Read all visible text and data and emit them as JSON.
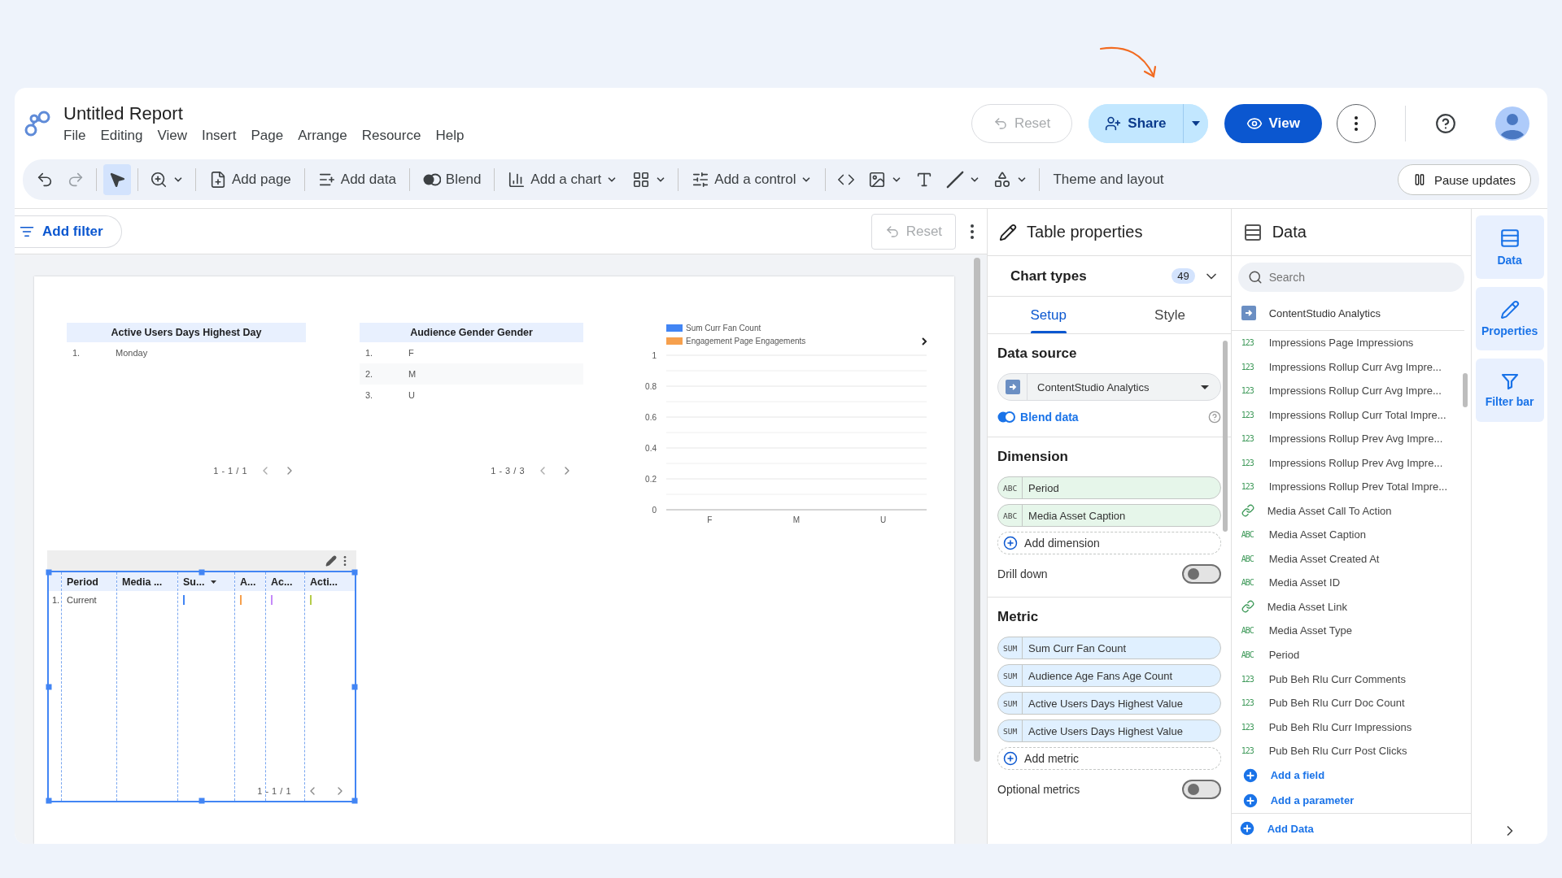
{
  "header": {
    "title": "Untitled Report",
    "menu": [
      "File",
      "Editing",
      "View",
      "Insert",
      "Page",
      "Arrange",
      "Resource",
      "Help"
    ],
    "reset": {
      "label": "Reset",
      "disabled": true
    },
    "share": "Share",
    "view": "View"
  },
  "toolbar": {
    "pointer": {
      "selected": true
    },
    "add_page": "Add page",
    "add_data": "Add data",
    "blend": "Blend",
    "add_chart": "Add a chart",
    "add_control": "Add a control",
    "theme": "Theme and layout",
    "pause": "Pause updates"
  },
  "filter_bar": {
    "add_filter": "Add filter",
    "reset": {
      "label": "Reset",
      "disabled": true
    }
  },
  "canvas": {
    "table_1": {
      "header": "Active Users Days Highest Day",
      "rows": [
        {
          "index": "1.",
          "value": "Monday"
        }
      ],
      "pagination": "1 - 1 / 1"
    },
    "table_2": {
      "header": "Audience Gender Gender",
      "rows": [
        {
          "index": "1.",
          "value": "F"
        },
        {
          "index": "2.",
          "value": "M"
        },
        {
          "index": "3.",
          "value": "U"
        }
      ],
      "pagination": "1 - 3 / 3"
    },
    "chart": {
      "chart_data": {
        "type": "bar",
        "categories": [
          "F",
          "M",
          "U"
        ],
        "series": [
          {
            "name": "Sum Curr Fan Count",
            "color": "#4285f4",
            "values": [
              null,
              null,
              null
            ]
          },
          {
            "name": "Engagement Page Engagements",
            "color": "#f6a04d",
            "values": [
              null,
              null,
              null
            ]
          }
        ],
        "ylim": [
          0,
          1
        ],
        "yticks": [
          0,
          0.2,
          0.4,
          0.6,
          0.8,
          1
        ],
        "grid": true
      }
    },
    "selected_table": {
      "columns": [
        {
          "label": "Period",
          "sorted": false
        },
        {
          "label": "Media ...",
          "sorted": false
        },
        {
          "label": "Su...",
          "sorted": true
        },
        {
          "label": "A...",
          "sorted": false
        },
        {
          "label": "Ac...",
          "sorted": false
        },
        {
          "label": "Acti...",
          "sorted": false
        }
      ],
      "rows": [
        {
          "index": "1.",
          "cells": [
            {
              "kind": "text",
              "text": "Current"
            },
            {
              "kind": "blank"
            },
            {
              "kind": "bar",
              "color": "#4285f4"
            },
            {
              "kind": "bar",
              "color": "#f6a04d"
            },
            {
              "kind": "bar",
              "color": "#c58af9"
            },
            {
              "kind": "bar",
              "color": "#b5cc4a"
            }
          ]
        }
      ],
      "pagination": "1 - 1 / 1"
    }
  },
  "properties": {
    "title": "Table properties",
    "chart_types": {
      "label": "Chart types",
      "count": "49"
    },
    "tabs": [
      {
        "label": "Setup",
        "selected": true
      },
      {
        "label": "Style",
        "selected": false
      }
    ],
    "data_source": {
      "title": "Data source",
      "value": "ContentStudio Analytics",
      "blend": "Blend data"
    },
    "dimension": {
      "title": "Dimension",
      "fields": [
        {
          "type": "ABC",
          "name": "Period"
        },
        {
          "type": "ABC",
          "name": "Media Asset Caption"
        }
      ],
      "add": "Add dimension",
      "drill_down": {
        "label": "Drill down",
        "on": false
      }
    },
    "metric": {
      "title": "Metric",
      "fields": [
        {
          "type": "SUM",
          "name": "Sum Curr Fan Count"
        },
        {
          "type": "SUM",
          "name": "Audience Age Fans Age Count"
        },
        {
          "type": "SUM",
          "name": "Active Users Days Highest Value"
        },
        {
          "type": "SUM",
          "name": "Active Users Days Highest Value"
        }
      ],
      "add": "Add metric",
      "optional": {
        "label": "Optional metrics",
        "on": false
      }
    }
  },
  "data_panel": {
    "title": "Data",
    "search": {
      "placeholder": "Search"
    },
    "source": "ContentStudio Analytics",
    "fields": [
      {
        "kind": "badge",
        "badge": "123",
        "name": "Impressions Page Impressions"
      },
      {
        "kind": "badge",
        "badge": "123",
        "name": "Impressions Rollup Curr Avg Impre..."
      },
      {
        "kind": "badge",
        "badge": "123",
        "name": "Impressions Rollup Curr Avg Impre..."
      },
      {
        "kind": "badge",
        "badge": "123",
        "name": "Impressions Rollup Curr Total Impre..."
      },
      {
        "kind": "badge",
        "badge": "123",
        "name": "Impressions Rollup Prev Avg Impre..."
      },
      {
        "kind": "badge",
        "badge": "123",
        "name": "Impressions Rollup Prev Avg Impre..."
      },
      {
        "kind": "badge",
        "badge": "123",
        "name": "Impressions Rollup Prev Total Impre..."
      },
      {
        "kind": "link",
        "name": "Media Asset Call To Action"
      },
      {
        "kind": "badge",
        "badge": "ABC",
        "name": "Media Asset Caption"
      },
      {
        "kind": "badge",
        "badge": "ABC",
        "name": "Media Asset Created At"
      },
      {
        "kind": "badge",
        "badge": "ABC",
        "name": "Media Asset ID"
      },
      {
        "kind": "link",
        "name": "Media Asset Link"
      },
      {
        "kind": "badge",
        "badge": "ABC",
        "name": "Media Asset Type"
      },
      {
        "kind": "badge",
        "badge": "ABC",
        "name": "Period"
      },
      {
        "kind": "badge",
        "badge": "123",
        "name": "Pub Beh Rlu Curr Comments"
      },
      {
        "kind": "badge",
        "badge": "123",
        "name": "Pub Beh Rlu Curr Doc Count"
      },
      {
        "kind": "badge",
        "badge": "123",
        "name": "Pub Beh Rlu Curr Impressions"
      },
      {
        "kind": "badge",
        "badge": "123",
        "name": "Pub Beh Rlu Curr Post Clicks"
      }
    ],
    "add_field": "Add a field",
    "add_parameter": "Add a parameter",
    "add_data": "Add Data"
  },
  "rail": [
    {
      "kind": "data",
      "label": "Data"
    },
    {
      "kind": "properties",
      "label": "Properties"
    },
    {
      "kind": "filter",
      "label": "Filter bar"
    }
  ]
}
